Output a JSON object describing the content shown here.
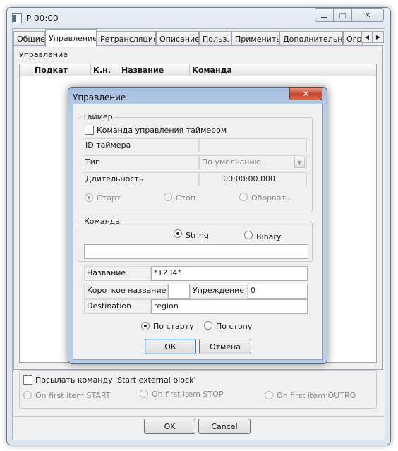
{
  "window": {
    "title": "P 00:00",
    "controls": {
      "minimize_icon": "minimize-icon",
      "maximize_icon": "maximize-icon",
      "close_glyph": "✕"
    }
  },
  "tabs": [
    {
      "label": "Общие",
      "active": false
    },
    {
      "label": "Управление",
      "active": true
    },
    {
      "label": "Ретрансляция",
      "active": false
    },
    {
      "label": "Описание",
      "active": false
    },
    {
      "label": "Польз.",
      "active": false
    },
    {
      "label": "Применить",
      "active": false
    },
    {
      "label": "Дополнительно",
      "active": false
    },
    {
      "label": "Огр",
      "active": false
    }
  ],
  "tab_scroll": {
    "left": "◀",
    "right": "▶"
  },
  "panel": {
    "section_label": "Управление",
    "columns": [
      "Подкат",
      "К.н.",
      "Название",
      "Команда"
    ]
  },
  "dialog": {
    "title": "Управление",
    "close_glyph": "✕",
    "timer": {
      "group_label": "Таймер",
      "checkbox_label": "Команда управления таймером",
      "checked": false,
      "id_label": "ID таймера",
      "id_value": "",
      "type_label": "Тип",
      "type_value": "По умолчанию",
      "duration_label": "Длительность",
      "duration_value": "00:00:00.000",
      "radios": [
        {
          "label": "Старт",
          "selected": true
        },
        {
          "label": "Стоп",
          "selected": false
        },
        {
          "label": "Оборвать",
          "selected": false
        }
      ]
    },
    "command": {
      "group_label": "Команда",
      "radios": [
        {
          "label": "String",
          "selected": true
        },
        {
          "label": "Binary",
          "selected": false
        }
      ],
      "value": ""
    },
    "fields": {
      "name_label": "Название",
      "name_value": "*1234*",
      "short_name_label": "Короткое название",
      "short_name_value": "",
      "lead_label": "Упреждение",
      "lead_value": "0",
      "destination_label": "Destination",
      "destination_value": "region"
    },
    "trigger": [
      {
        "label": "По старту",
        "selected": true
      },
      {
        "label": "По стопу",
        "selected": false
      }
    ],
    "ok_label": "ОК",
    "cancel_label": "Отмена"
  },
  "external": {
    "checkbox_label": "Посылать команду 'Start external block'",
    "checked": false,
    "radios": [
      {
        "label": "On first item START"
      },
      {
        "label": "On first item STOP"
      },
      {
        "label": "On first item OUTRO"
      }
    ]
  },
  "footer": {
    "ok_label": "OK",
    "cancel_label": "Cancel"
  }
}
